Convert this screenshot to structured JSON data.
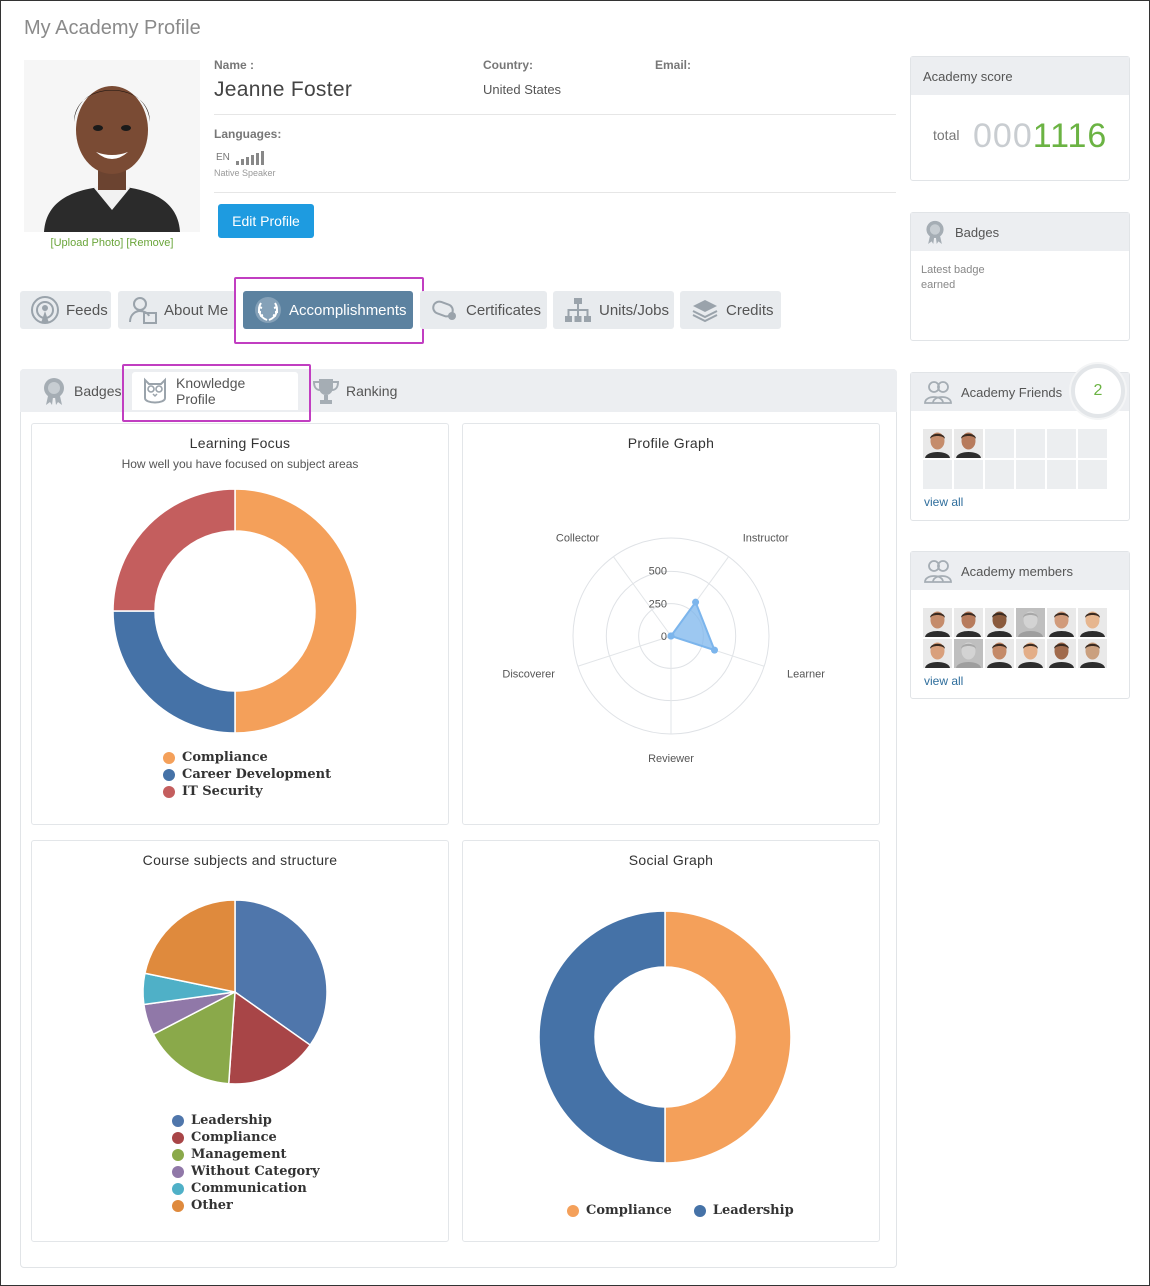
{
  "page": {
    "title": "My Academy Profile"
  },
  "profile": {
    "name_label": "Name :",
    "name": "Jeanne Foster",
    "country_label": "Country:",
    "country": "United States",
    "email_label": "Email:",
    "languages_label": "Languages:",
    "language_code": "EN",
    "language_level": "Native Speaker",
    "upload_photo": "[Upload Photo]",
    "remove_photo": "[Remove]",
    "edit_button": "Edit Profile"
  },
  "tabs": {
    "feeds": "Feeds",
    "about": "About Me",
    "accomplishments": "Accomplishments",
    "certificates": "Certificates",
    "units": "Units/Jobs",
    "credits": "Credits"
  },
  "subtabs": {
    "badges": "Badges",
    "knowledge": "Knowledge Profile",
    "ranking": "Ranking"
  },
  "sidebar": {
    "score_title": "Academy score",
    "score_total_label": "total",
    "score_prefix": "000",
    "score_value": "1116",
    "badges_title": "Badges",
    "latest_badge_line1": "Latest badge",
    "latest_badge_line2": "earned",
    "friends_title": "Academy Friends",
    "friends_count": "2",
    "friends_view_all": "view all",
    "members_title": "Academy members",
    "members_view_all": "view all"
  },
  "colors": {
    "accent": "#1e9be0",
    "active_tab": "#5c82a0",
    "score_green": "#6bb343",
    "highlight": "#c13ec1"
  },
  "chart_data": [
    {
      "type": "pie",
      "title": "Learning Focus",
      "subtitle": "How well you have focused on subject areas",
      "donut": true,
      "slices": [
        {
          "label": "Compliance",
          "value": 50,
          "color": "#f4a05a"
        },
        {
          "label": "Career Development",
          "value": 25,
          "color": "#4572a7"
        },
        {
          "label": "IT Security",
          "value": 25,
          "color": "#c45e5e"
        }
      ]
    },
    {
      "type": "radar",
      "title": "Profile Graph",
      "axes": [
        "Instructor",
        "Learner",
        "Reviewer",
        "Discoverer",
        "Collector"
      ],
      "ticks": [
        0,
        250,
        500
      ],
      "rmax": 750,
      "values": [
        320,
        350,
        0,
        0,
        0
      ],
      "color": "#7cb5ec"
    },
    {
      "type": "pie",
      "title": "Course subjects and structure",
      "donut": false,
      "slices": [
        {
          "label": "Leadership",
          "value": 32,
          "color": "#4f76ab"
        },
        {
          "label": "Compliance",
          "value": 15,
          "color": "#a84547"
        },
        {
          "label": "Management",
          "value": 15,
          "color": "#8aa94a"
        },
        {
          "label": "Without Category",
          "value": 5,
          "color": "#9078a8"
        },
        {
          "label": "Communication",
          "value": 5,
          "color": "#4fb0c7"
        },
        {
          "label": "Other",
          "value": 20,
          "color": "#df8a3d"
        }
      ]
    },
    {
      "type": "pie",
      "title": "Social Graph",
      "donut": true,
      "slices": [
        {
          "label": "Compliance",
          "value": 50,
          "color": "#f4a05a"
        },
        {
          "label": "Leadership",
          "value": 50,
          "color": "#4572a7"
        }
      ]
    }
  ]
}
